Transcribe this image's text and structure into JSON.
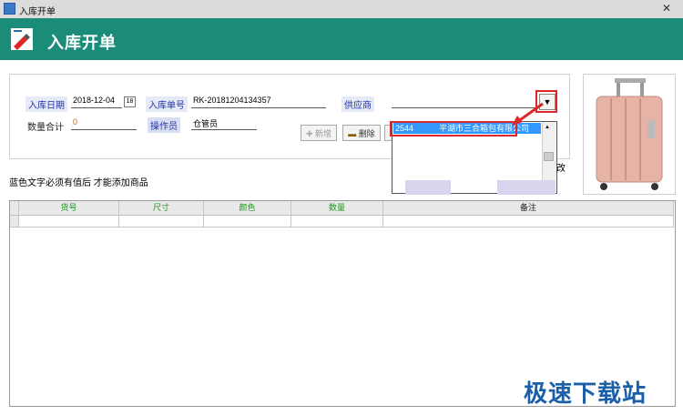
{
  "window": {
    "title": "入库开单"
  },
  "banner": {
    "title": "入库开单"
  },
  "form": {
    "date_label": "入库日期",
    "date_value": "2018-12-04",
    "date_picker": "18",
    "order_label": "入库单号",
    "order_value": "RK-20181204134357",
    "supplier_label": "供应商",
    "total_label": "数量合计",
    "total_value": "0",
    "operator_label": "操作员",
    "operator_value": "仓管员",
    "add_label": "新增",
    "delete_label": "删除"
  },
  "dropdown": {
    "rows": [
      {
        "code": "2544",
        "name": "平湖市三合箱包有限公司"
      }
    ],
    "overflow_text": "改"
  },
  "hint": "蓝色文字必须有值后 才能添加商品",
  "grid": {
    "columns": [
      "货号",
      "尺寸",
      "颜色",
      "数量",
      "备注"
    ]
  },
  "watermark": "极速下载站",
  "colors": {
    "banner": "#1a8c79",
    "highlight": "#e0262b",
    "selection": "#3399ff"
  }
}
